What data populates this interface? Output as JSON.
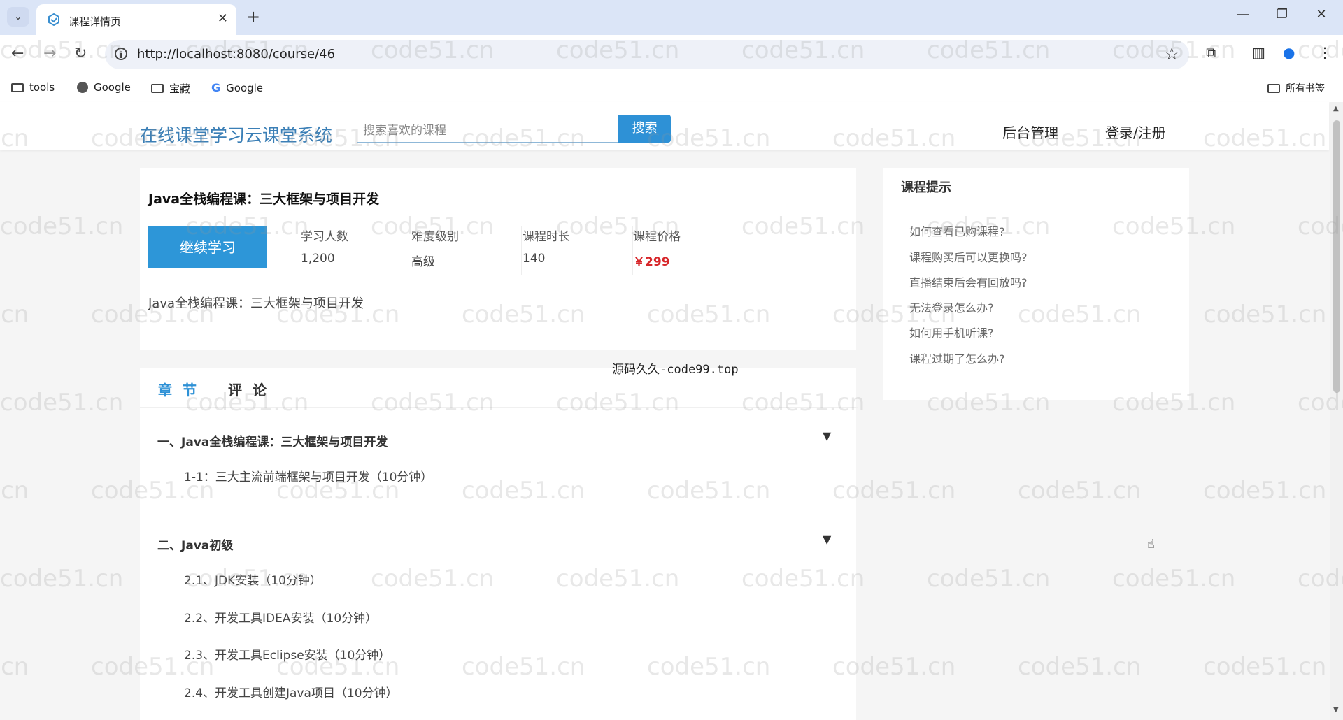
{
  "browser": {
    "tab_title": "课程详情页",
    "url": "http://localhost:8080/course/46",
    "bookmarks": [
      {
        "label": "tools",
        "icon": "folder-icon"
      },
      {
        "label": "Google",
        "icon": "globe-icon"
      },
      {
        "label": "宝藏",
        "icon": "folder-icon"
      },
      {
        "label": "Google",
        "icon": "google-icon"
      }
    ],
    "all_bookmarks": "所有书签"
  },
  "header": {
    "logo": "在线课堂学习云课堂系统",
    "search_placeholder": "搜索喜欢的课程",
    "search_button": "搜索",
    "nav": [
      "后台管理",
      "登录/注册"
    ]
  },
  "course": {
    "title": "Java全栈编程课：三大框架与项目开发",
    "continue_button": "继续学习",
    "stats": [
      {
        "label": "学习人数",
        "value": "1,200"
      },
      {
        "label": "难度级别",
        "value": "高级"
      },
      {
        "label": "课程时长",
        "value": "140"
      },
      {
        "label": "课程价格",
        "value": "￥299"
      }
    ],
    "description": "Java全栈编程课：三大框架与项目开发"
  },
  "content_tabs": [
    "章 节",
    "评 论"
  ],
  "chapters": [
    {
      "title": "一、Java全栈编程课：三大框架与项目开发",
      "lessons": [
        "1-1：三大主流前端框架与项目开发（10分钟）"
      ]
    },
    {
      "title": "二、Java初级",
      "lessons": [
        "2.1、JDK安装（10分钟）",
        "2.2、开发工具IDEA安装（10分钟）",
        "2.3、开发工具Eclipse安装（10分钟）",
        "2.4、开发工具创建Java项目（10分钟）"
      ]
    }
  ],
  "tips": {
    "title": "课程提示",
    "items": [
      "如何查看已购课程?",
      "课程购买后可以更换吗?",
      "直播结束后会有回放吗?",
      "无法登录怎么办?",
      "如何用手机听课?",
      "课程过期了怎么办?"
    ]
  },
  "overlay_text": "源码久久-code99.top",
  "watermark": "code51.cn",
  "colors": {
    "brand": "#2e91d6",
    "price": "#d7262a",
    "logo": "#3b7fb6"
  }
}
